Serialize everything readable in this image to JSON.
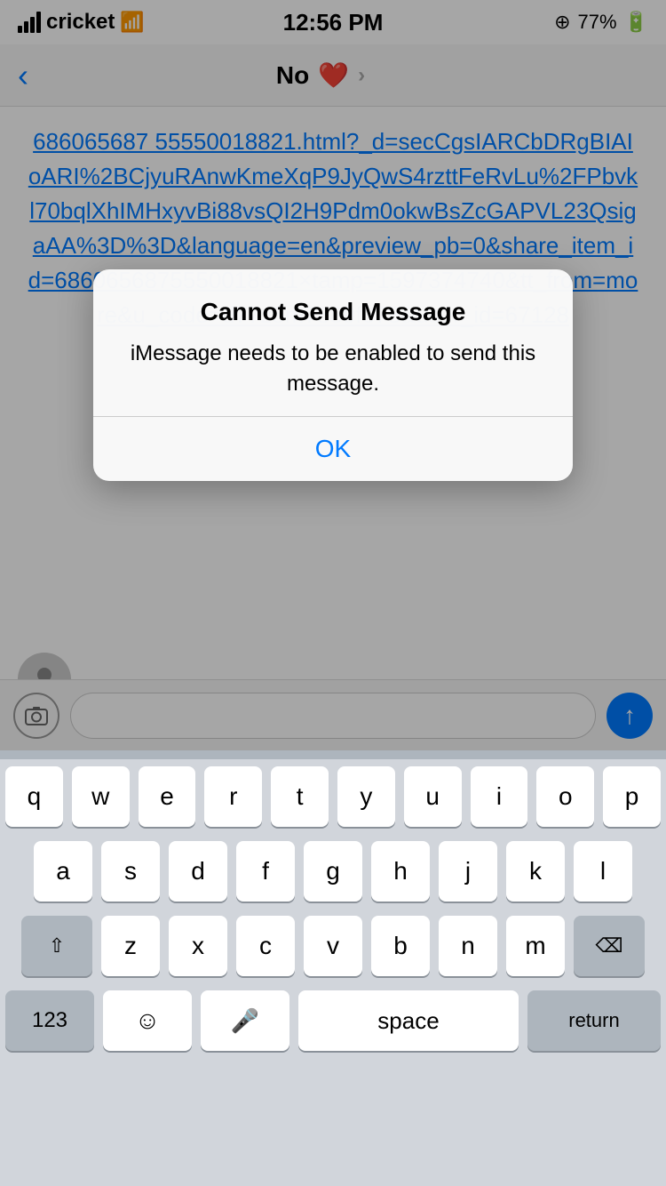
{
  "statusBar": {
    "carrier": "cricket",
    "time": "12:56 PM",
    "battery": "77%",
    "signal_bars": [
      8,
      14,
      20,
      26
    ],
    "location_icon": "⊕"
  },
  "navBar": {
    "back_label": "‹",
    "title": "No",
    "heart": "❤️",
    "chevron": "›"
  },
  "message": {
    "link_text": "686065687 55550018821.html?_d=secCgsIARCbDRgBIAIoARI%2BCjyuRAnwKmeXqP9JyQwS4rzttFeRvLu%2FPbvkl70bqlXhIMHxyvBi88vsQI2H9Pdm0okwBsZcGAPVL23QsigaAA%3D%3D&language=en&preview_pb=0&share_item_id=6860656875550018821&timestamp=1597374740&tt_from=more&u_code=d77z5m7889f678&user_id=67128"
  },
  "inputBar": {
    "camera_icon": "📷",
    "send_icon": "↑"
  },
  "dialog": {
    "title": "Cannot Send Message",
    "message": "iMessage needs to be enabled to send this message.",
    "ok_label": "OK"
  },
  "keyboard": {
    "row1": [
      "q",
      "w",
      "e",
      "r",
      "t",
      "y",
      "u",
      "i",
      "o",
      "p"
    ],
    "row2": [
      "a",
      "s",
      "d",
      "f",
      "g",
      "h",
      "j",
      "k",
      "l"
    ],
    "row3": [
      "z",
      "x",
      "c",
      "v",
      "b",
      "n",
      "m"
    ],
    "bottom": {
      "numbers": "123",
      "emoji": "☺",
      "mic": "🎤",
      "space": "space",
      "return": "return"
    }
  }
}
